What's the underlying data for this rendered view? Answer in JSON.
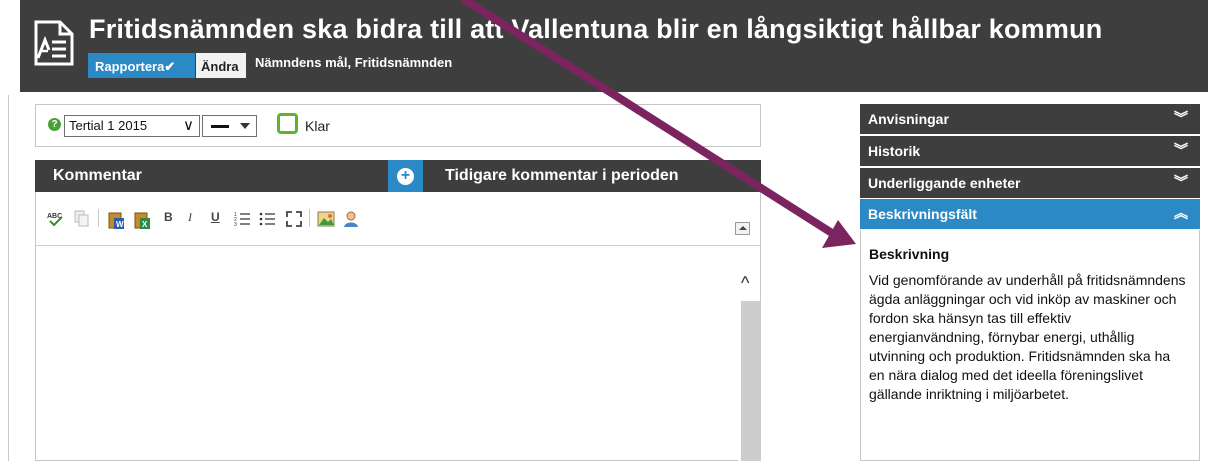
{
  "header": {
    "title": "Fritidsnämnden ska bidra till att Vallentuna blir en långsiktigt hållbar kommun",
    "report_button": "Rapportera",
    "report_check": "✔",
    "edit_button": "Ändra",
    "breadcrumb": "Nämndens mål, Fritidsnämnden"
  },
  "period_bar": {
    "help": "?",
    "period_value": "Tertial 1 2015",
    "period_chevron": "∨",
    "done_label": "Klar"
  },
  "comment": {
    "title": "Kommentar",
    "add": "+",
    "previous_label": "Tidigare kommentar i perioden",
    "toolbar": {
      "bold": "B",
      "italic": "I",
      "underline": "U"
    },
    "scroll_up": "^"
  },
  "sidebar": {
    "items": [
      {
        "label": "Anvisningar",
        "chevron": "︾"
      },
      {
        "label": "Historik",
        "chevron": "︾"
      },
      {
        "label": "Underliggande enheter",
        "chevron": "︾"
      },
      {
        "label": "Beskrivningsfält",
        "chevron": "︽"
      }
    ],
    "description": {
      "title": "Beskrivning",
      "text": "Vid genomförande av underhåll på fritidsnämndens ägda anläggningar och vid inköp av maskiner och fordon ska hänsyn tas till effektiv energianvändning, förnybar energi, uthållig utvinning och produktion. Fritidsnämnden ska ha en nära dialog med det ideella föreningslivet gällande inriktning i miljöarbetet."
    }
  },
  "colors": {
    "header_bg": "#3e3e3e",
    "accent_blue": "#2b89c6",
    "done_green": "#5fb42d",
    "arrow_purple": "#7b2460"
  }
}
